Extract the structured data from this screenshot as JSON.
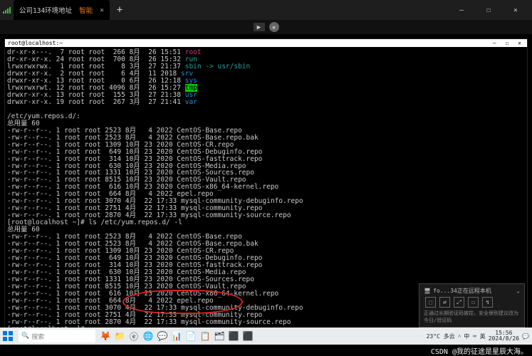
{
  "tab": {
    "title": "公司134环境地址",
    "smart": "智能",
    "close": "✕"
  },
  "window": {
    "min": "—",
    "max": "☐",
    "close": "✕"
  },
  "term_title": {
    "host": "root@localhost:~",
    "controls": "—  ☐  ✕"
  },
  "top_ls": [
    "dr-xr-x---.  7 root root  266 8月  26 15:51 ",
    "dr-xr-xr-x. 24 root root  700 8月  26 15:32 ",
    "lrwxrwxrwx.  1 root root    8 3月  27 21:37 ",
    "drwxr-xr-x.  2 root root    6 4月  11 2018 ",
    "drwxr-xr-x. 13 root root    0 6月  26 12:18 ",
    "lrwxrwxrwt. 12 root root 4096 8月  26 15:27 ",
    "drwxr-xr-x. 13 root root  155 3月  27 21:38 ",
    "drwxr-xr-x. 19 root root  267 3月  27 21:41 "
  ],
  "top_ls_names": [
    "root",
    "run",
    "sbin -> usr/sbin",
    "srv",
    "sys",
    "tmp",
    "usr",
    "var"
  ],
  "section_header": "/etc/yum.repos.d/:",
  "total": "总用量 60",
  "repo_common": [
    "-rw-r--r--. 1 root root 2523 8月   4 2022 CentOS-Base.repo",
    "-rw-r--r--. 1 root root 2523 8月   4 2022 CentOS-Base.repo.bak",
    "-rw-r--r--. 1 root root 1309 10月 23 2020 CentOS-CR.repo",
    "-rw-r--r--. 1 root root  649 10月 23 2020 CentOS-Debuginfo.repo",
    "-rw-r--r--. 1 root root  314 10月 23 2020 CentOS-fasttrack.repo",
    "-rw-r--r--. 1 root root  630 10月 23 2020 CentOS-Media.repo",
    "-rw-r--r--. 1 root root 1331 10月 23 2020 CentOS-Sources.repo",
    "-rw-r--r--. 1 root root 8515 10月 23 2020 CentOS-Vault.repo",
    "-rw-r--r--. 1 root root  616 10月 23 2020 CentOS-x86_64-kernel.repo",
    "-rw-r--r--. 1 root root  664 8月   4 2022 epel.repo",
    "-rw-r--r--. 1 root root 3070 4月  22 17:33 mysql-community-debuginfo.repo",
    "-rw-r--r--. 1 root root 2751 4月  22 17:33 mysql-community.repo",
    "-rw-r--r--. 1 root root 2870 4月  22 17:33 mysql-community-source.repo"
  ],
  "cmd": "[root@localhost ~]# ls /etc/yum.repos.d/ -l",
  "prompt": "[root@localhost ~]# ",
  "toast": {
    "title": "fo...34正在远程本机",
    "msg": "正通过长期验证码被控，安全保别建议改为今日/验证码"
  },
  "search": {
    "placeholder": "搜索"
  },
  "clock": {
    "time": "15:56",
    "date": "2024/8/26"
  },
  "weather": "23°C 多云",
  "ime": "中 ⌨ 英",
  "watermark": "CSDN @我的征途是星辰大海。",
  "toast_icons": [
    "⬚",
    "⇄",
    "⤢",
    "☐",
    "↯"
  ]
}
